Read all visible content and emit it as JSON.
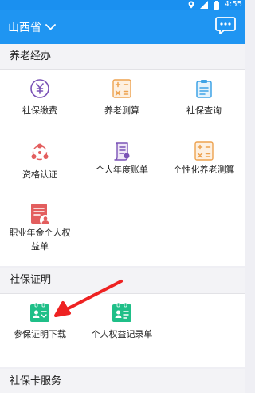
{
  "status_bar": {
    "time": "4:55",
    "icons": [
      "location-icon",
      "signal-icon",
      "battery-icon"
    ]
  },
  "app_bar": {
    "province": "山西省",
    "chat_icon": "chat-bubble-icon"
  },
  "sections": {
    "pension": {
      "title": "养老经办",
      "items": [
        {
          "label": "社保缴费",
          "icon": "yuan-coin-icon"
        },
        {
          "label": "养老测算",
          "icon": "calculator-icon"
        },
        {
          "label": "社保查询",
          "icon": "clipboard-icon"
        },
        {
          "label": "资格认证",
          "icon": "user-network-icon"
        },
        {
          "label": "个人年度账单",
          "icon": "scroll-bill-icon"
        },
        {
          "label": "个性化养老测算",
          "icon": "calculator-icon"
        },
        {
          "label": "职业年金个人权益单",
          "icon": "document-user-icon"
        }
      ]
    },
    "certificate": {
      "title": "社保证明",
      "items": [
        {
          "label": "参保证明下载",
          "icon": "certificate-download-icon"
        },
        {
          "label": "个人权益记录单",
          "icon": "certificate-record-icon"
        }
      ]
    },
    "card": {
      "title": "社保卡服务"
    }
  },
  "colors": {
    "app_bar": "#1f95f2",
    "purple": "#7a52b6",
    "orange": "#eda24f",
    "blue": "#3fa3e6",
    "red": "#e35e5e",
    "green": "#1fbf88",
    "arrow": "#ee2222"
  }
}
